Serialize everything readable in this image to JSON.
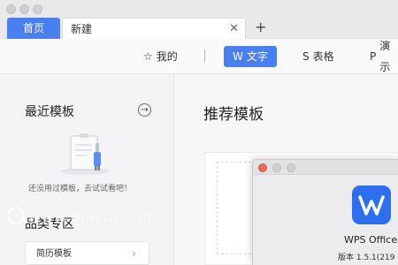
{
  "tabs": {
    "home_label": "首页",
    "new_label": "新建",
    "close_glyph": "✕",
    "add_glyph": "+"
  },
  "toolbar": {
    "mine": {
      "icon": "star-icon",
      "glyph": "☆",
      "label": "我的"
    },
    "writer": {
      "icon": "writer-icon",
      "glyph": "W",
      "label": "文字",
      "active": true
    },
    "sheets": {
      "icon": "sheets-icon",
      "glyph": "S",
      "label": "表格"
    },
    "slides": {
      "icon": "slides-icon",
      "glyph": "P",
      "label": "演示"
    }
  },
  "left": {
    "recent_title": "最近模板",
    "recent_arrow_glyph": "→",
    "empty_text": "还没用过模板，去试试看吧！",
    "category_title": "品类专区",
    "category_items": [
      {
        "label": "简历模板",
        "chevron": "›"
      }
    ]
  },
  "right": {
    "recommend_title": "推荐模板"
  },
  "about_dialog": {
    "app_name": "WPS Office",
    "version": "版本 1.5.1(219"
  },
  "watermark": "www.macjb.com",
  "colors": {
    "accent": "#4a7ff0",
    "logo": "#2e6fef"
  }
}
